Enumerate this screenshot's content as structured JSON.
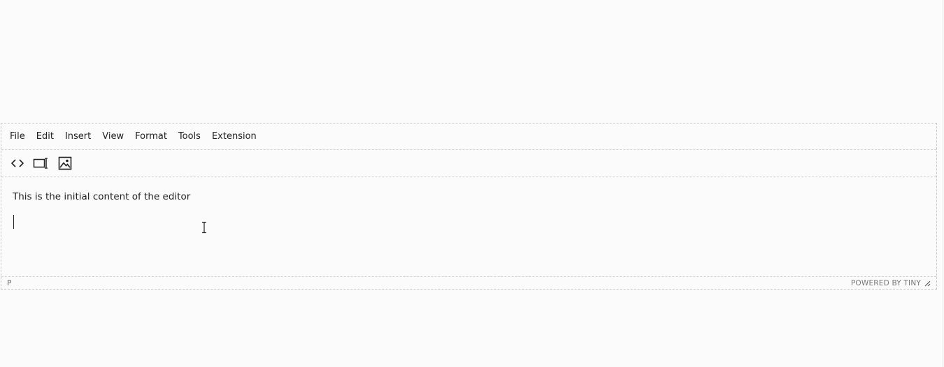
{
  "menubar": {
    "items": [
      {
        "label": "File"
      },
      {
        "label": "Edit"
      },
      {
        "label": "Insert"
      },
      {
        "label": "View"
      },
      {
        "label": "Format"
      },
      {
        "label": "Tools"
      },
      {
        "label": "Extension"
      }
    ]
  },
  "toolbar": {
    "buttons": [
      {
        "icon": "source-code-icon"
      },
      {
        "icon": "preview-icon"
      },
      {
        "icon": "image-icon"
      }
    ]
  },
  "content": {
    "paragraph": "This is the initial content of the editor"
  },
  "statusbar": {
    "path": "P",
    "branding": "POWERED BY TINY"
  }
}
